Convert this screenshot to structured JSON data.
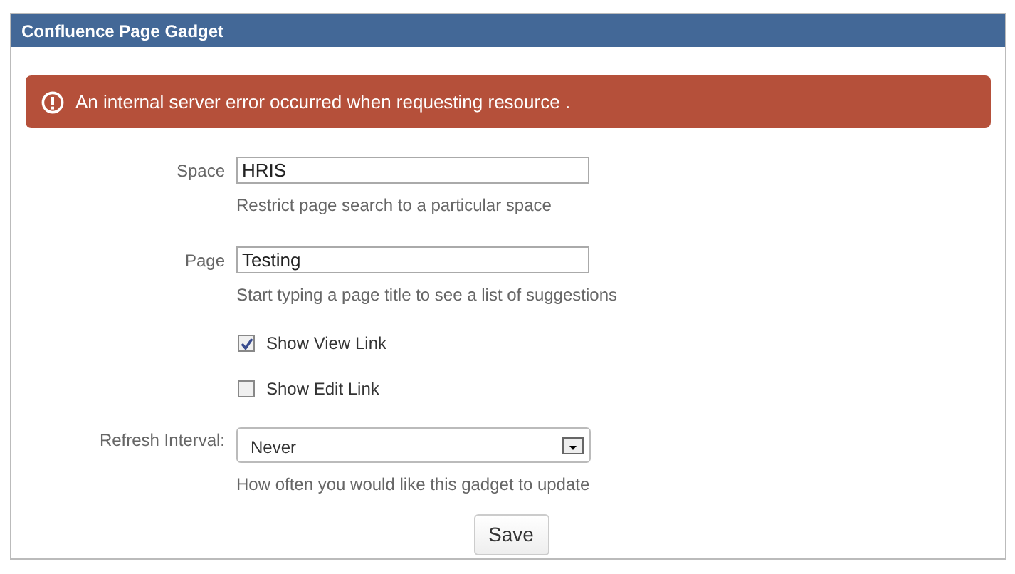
{
  "panel": {
    "title": "Confluence Page Gadget"
  },
  "error": {
    "message": "An internal server error occurred when requesting resource ."
  },
  "fields": [
    {
      "kind": "text",
      "label": "Space",
      "value": "HRIS",
      "hint": "Restrict page search to a particular space"
    },
    {
      "kind": "text",
      "label": "Page",
      "value": "Testing",
      "hint": "Start typing a page title to see a list of suggestions"
    },
    {
      "kind": "checkbox",
      "label": "Show View Link",
      "checked": true
    },
    {
      "kind": "checkbox",
      "label": "Show Edit Link",
      "checked": false
    },
    {
      "kind": "select",
      "label": "Refresh Interval:",
      "value": "Never",
      "hint": "How often you would like this gadget to update"
    }
  ],
  "buttons": [
    "Save"
  ]
}
